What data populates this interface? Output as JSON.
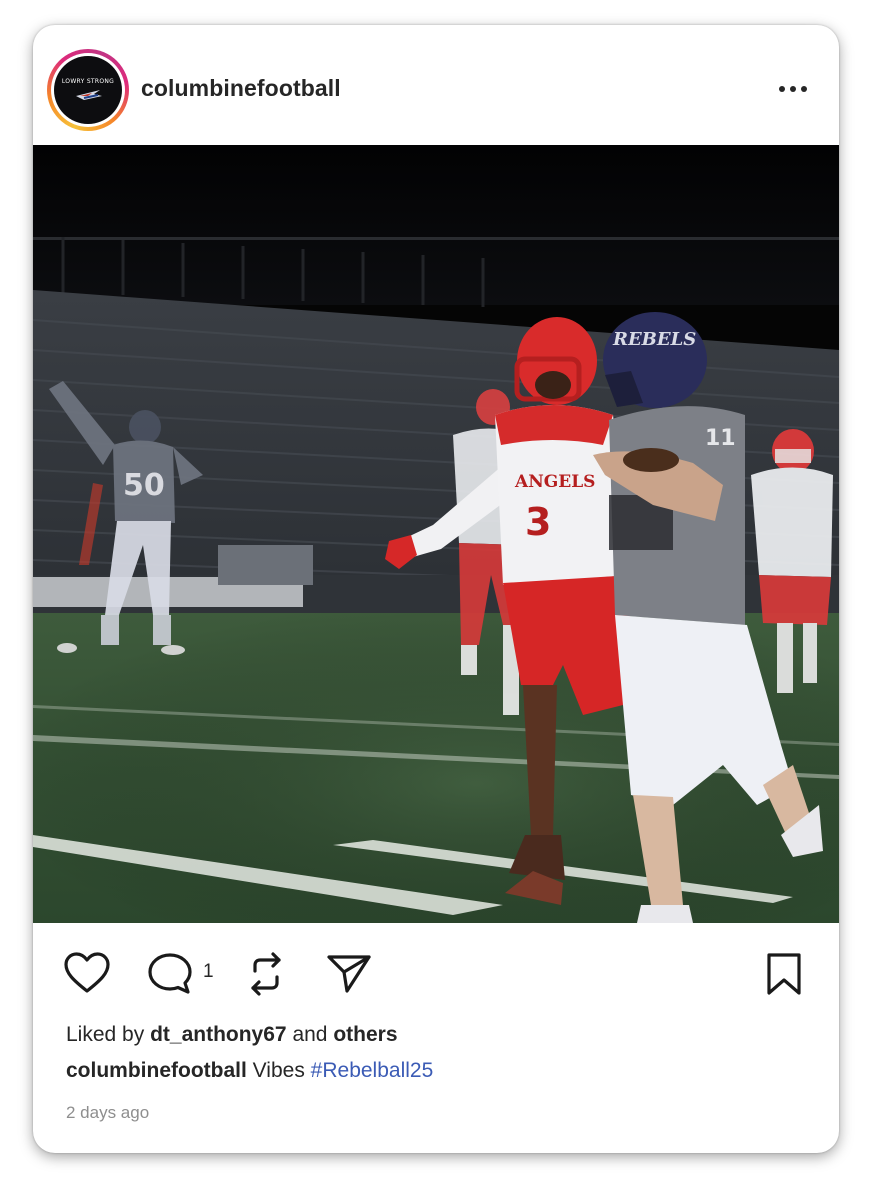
{
  "post": {
    "account": {
      "username": "columbinefootball",
      "avatar_text": "LOWRY STRONG"
    },
    "photo": {
      "jersey_left": "50",
      "jersey_runner": "11",
      "helmet_text": "REBELS",
      "defender_jersey_text": "ANGELS",
      "defender_number": "3"
    },
    "actions": {
      "comment_count": "1"
    },
    "likes": {
      "prefix": "Liked by",
      "user": "dt_anthony67",
      "connector": "and",
      "suffix": "others"
    },
    "caption": {
      "username": "columbinefootball",
      "text": "Vibes",
      "hashtag": "#Rebelball25"
    },
    "timestamp": "2 days ago"
  },
  "icons": {
    "more": "more-horizontal-icon",
    "like": "heart-icon",
    "comment": "comment-bubble-icon",
    "repost": "repost-icon",
    "share": "paper-plane-icon",
    "save": "bookmark-icon"
  },
  "colors": {
    "text_primary": "#262626",
    "text_secondary": "#8e8e8e",
    "hashtag": "#3b5bb5",
    "story_ring_start": "#f7c23a",
    "story_ring_end": "#c13584"
  }
}
